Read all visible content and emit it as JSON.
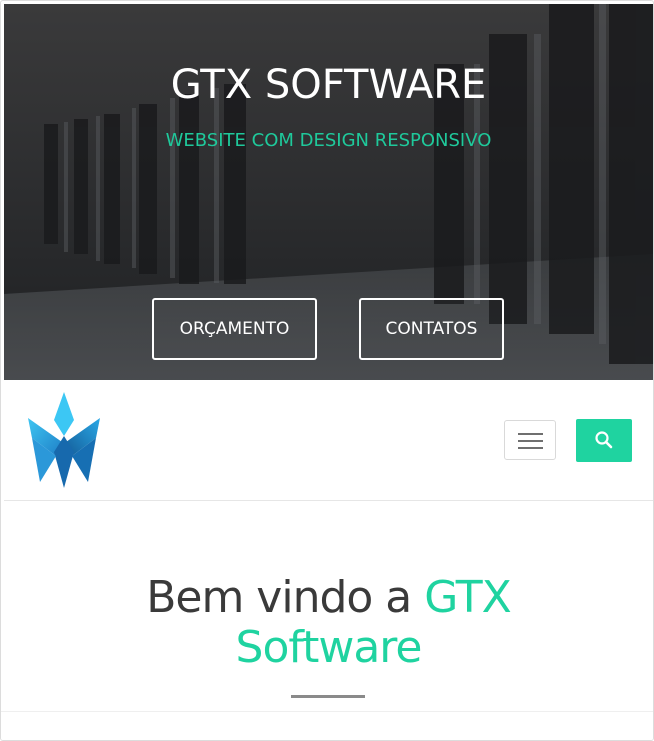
{
  "hero": {
    "title": "GTX SOFTWARE",
    "subtitle": "WEBSITE COM DESIGN RESPONSIVO",
    "buttons": [
      {
        "label": "ORÇAMENTO"
      },
      {
        "label": "CONTATOS"
      }
    ]
  },
  "navbar": {
    "logo_icon": "gtx-triangle-logo",
    "menu_icon": "hamburger-icon",
    "search_icon": "search-icon"
  },
  "welcome": {
    "title_part1": "Bem vindo a ",
    "title_accent1": "GTX",
    "title_accent2": "Software"
  },
  "colors": {
    "accent": "#1fd3a0",
    "hero_bg": "#2a2a2b",
    "text_dark": "#3a3a3a"
  }
}
